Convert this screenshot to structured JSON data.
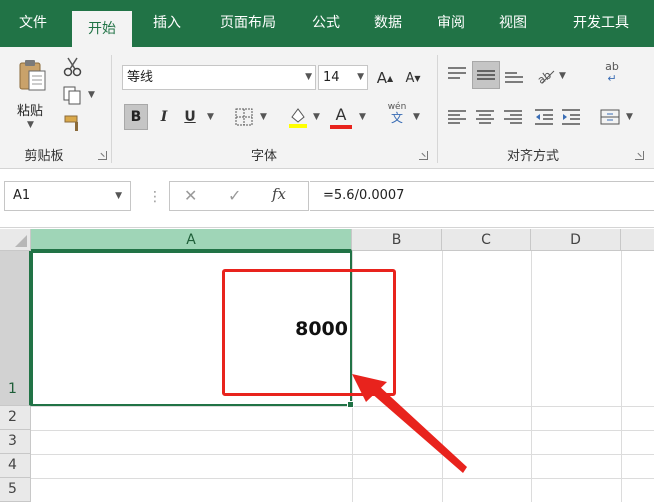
{
  "tabs": [
    "文件",
    "开始",
    "插入",
    "页面布局",
    "公式",
    "数据",
    "审阅",
    "视图",
    "开发工具"
  ],
  "active_tab": "开始",
  "ribbon": {
    "clipboard": {
      "paste_label": "粘贴",
      "group_label": "剪贴板"
    },
    "font": {
      "font_name": "等线",
      "font_size": "14",
      "bold": "B",
      "italic": "I",
      "underline": "U",
      "grow": "A",
      "shrink": "A",
      "font_color_letter": "A",
      "phonetic_top": "wén",
      "phonetic_bottom": "文",
      "group_label": "字体"
    },
    "alignment": {
      "group_label": "对齐方式",
      "wrap_icon": "ab"
    }
  },
  "formula_bar": {
    "name_box": "A1",
    "fx": "fx",
    "formula": "=5.6/0.0007"
  },
  "sheet": {
    "columns": [
      "A",
      "B",
      "C",
      "D"
    ],
    "rows": [
      "1",
      "2",
      "3",
      "4",
      "5"
    ],
    "cells": {
      "A1": "8000"
    },
    "selected_cell": "A1"
  },
  "colors": {
    "accent": "#217346",
    "annotation": "#e8231d",
    "selected_header": "#9fd5b7"
  }
}
